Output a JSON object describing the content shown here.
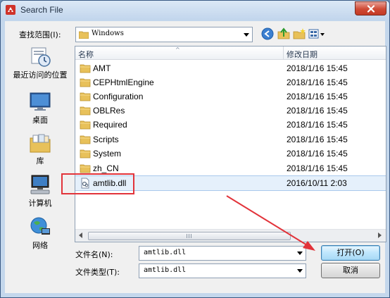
{
  "window": {
    "title": "Search File",
    "close_symbol": "✕"
  },
  "lookin": {
    "label": "查找范围(I):",
    "value": "Windows"
  },
  "places": [
    {
      "label": "最近访问的位置",
      "icon": "recent-places-icon"
    },
    {
      "label": "桌面",
      "icon": "desktop-icon"
    },
    {
      "label": "库",
      "icon": "libraries-icon"
    },
    {
      "label": "计算机",
      "icon": "computer-icon"
    },
    {
      "label": "网络",
      "icon": "network-icon"
    }
  ],
  "list": {
    "col_name": "名称",
    "col_date": "修改日期",
    "rows": [
      {
        "name": "AMT",
        "date": "2018/1/16 15:45",
        "type": "folder"
      },
      {
        "name": "CEPHtmlEngine",
        "date": "2018/1/16 15:45",
        "type": "folder"
      },
      {
        "name": "Configuration",
        "date": "2018/1/16 15:45",
        "type": "folder"
      },
      {
        "name": "OBLRes",
        "date": "2018/1/16 15:45",
        "type": "folder"
      },
      {
        "name": "Required",
        "date": "2018/1/16 15:45",
        "type": "folder"
      },
      {
        "name": "Scripts",
        "date": "2018/1/16 15:45",
        "type": "folder"
      },
      {
        "name": "System",
        "date": "2018/1/16 15:45",
        "type": "folder"
      },
      {
        "name": "zh_CN",
        "date": "2018/1/16 15:45",
        "type": "folder"
      },
      {
        "name": "amtlib.dll",
        "date": "2016/10/11 2:03",
        "type": "file"
      }
    ]
  },
  "filename": {
    "label": "文件名(N):",
    "value": "amtlib.dll"
  },
  "filetype": {
    "label": "文件类型(T):",
    "value": "amtlib.dll"
  },
  "buttons": {
    "open": "打开(O)",
    "cancel": "取消"
  },
  "colors": {
    "annotation_red": "#e2333a",
    "folder_yellow": "#e8c15a",
    "selection": "#e5f0fb"
  }
}
